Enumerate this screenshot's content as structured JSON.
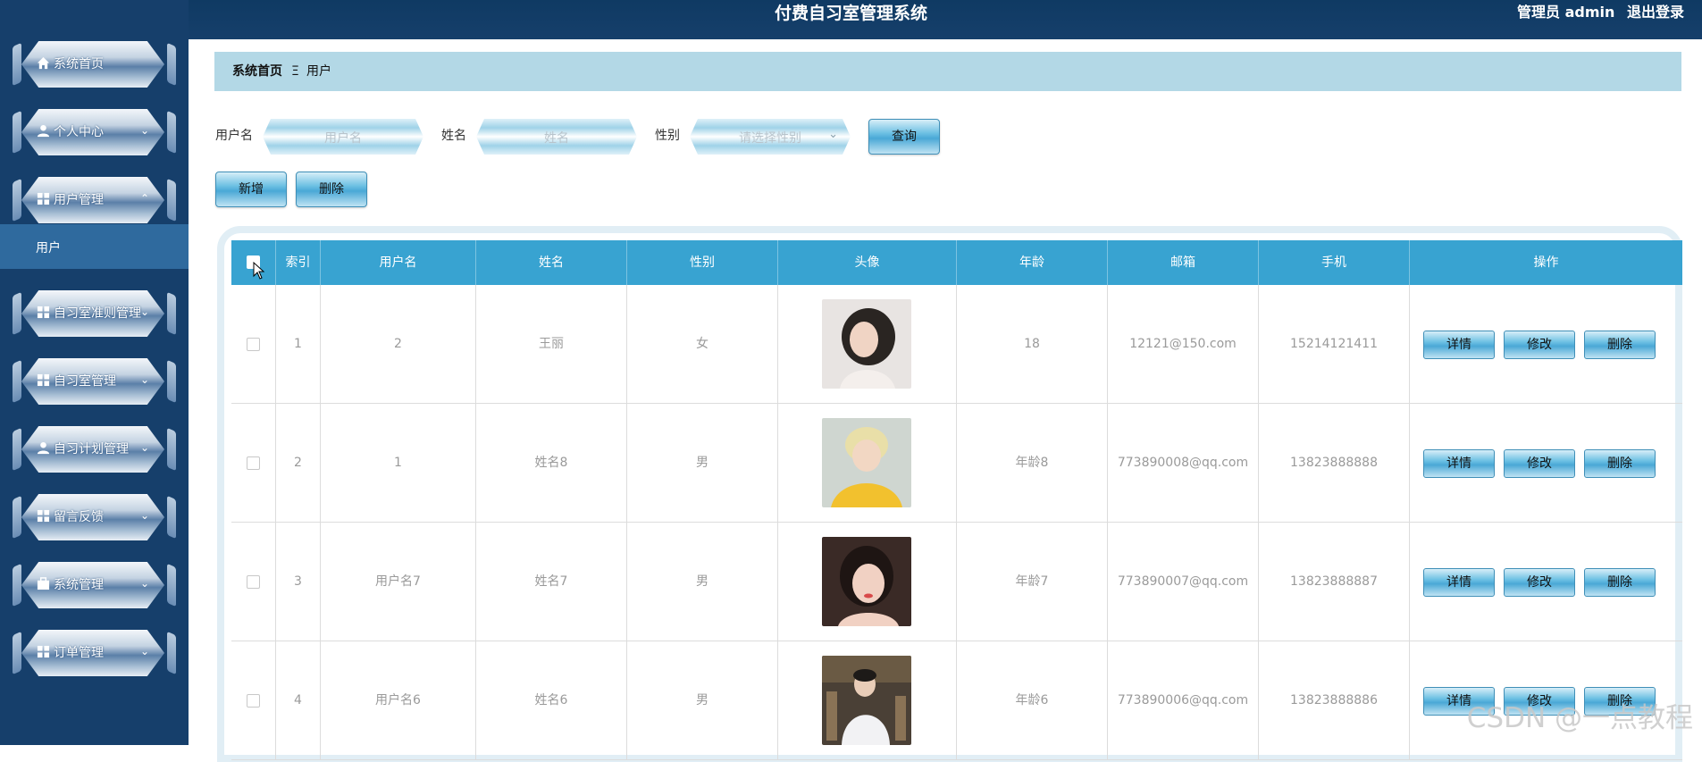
{
  "app": {
    "title": "付费自习室管理系统",
    "user": "管理员 admin",
    "logout": "退出登录"
  },
  "sidebar": {
    "items": [
      {
        "label": "系统首页",
        "icon": "home-icon"
      },
      {
        "label": "个人中心",
        "icon": "person-icon"
      },
      {
        "label": "用户管理",
        "icon": "grid-icon",
        "expanded": true
      },
      {
        "label": "自习室准则管理",
        "icon": "grid-icon"
      },
      {
        "label": "自习室管理",
        "icon": "grid-icon"
      },
      {
        "label": "自习计划管理",
        "icon": "person-icon"
      },
      {
        "label": "留言反馈",
        "icon": "grid-icon"
      },
      {
        "label": "系统管理",
        "icon": "briefcase-icon"
      },
      {
        "label": "订单管理",
        "icon": "grid-icon"
      }
    ],
    "submenu": {
      "label": "用户"
    }
  },
  "breadcrumb": {
    "home": "系统首页",
    "separator": "Ξ",
    "current": "用户"
  },
  "search": {
    "username_label": "用户名",
    "username_placeholder": "用户名",
    "name_label": "姓名",
    "name_placeholder": "姓名",
    "gender_label": "性别",
    "gender_placeholder": "请选择性别",
    "query_button": "查询"
  },
  "actions": {
    "add": "新增",
    "delete": "删除"
  },
  "table": {
    "headers": [
      "索引",
      "用户名",
      "姓名",
      "性别",
      "头像",
      "年龄",
      "邮箱",
      "手机",
      "操作"
    ],
    "rows": [
      {
        "index": "1",
        "username": "2",
        "name": "王丽",
        "gender": "女",
        "age": "18",
        "email": "12121@150.com",
        "phone": "15214121411"
      },
      {
        "index": "2",
        "username": "1",
        "name": "姓名8",
        "gender": "男",
        "age": "年龄8",
        "email": "773890008@qq.com",
        "phone": "13823888888"
      },
      {
        "index": "3",
        "username": "用户名7",
        "name": "姓名7",
        "gender": "男",
        "age": "年龄7",
        "email": "773890007@qq.com",
        "phone": "13823888887"
      },
      {
        "index": "4",
        "username": "用户名6",
        "name": "姓名6",
        "gender": "男",
        "age": "年龄6",
        "email": "773890006@qq.com",
        "phone": "13823888886"
      }
    ],
    "row_buttons": {
      "detail": "详情",
      "edit": "修改",
      "delete": "删除"
    }
  },
  "watermark": "CSDN @一点教程",
  "colors": {
    "topbar": "#0f3a63",
    "sidebar": "#163f6b",
    "header": "#38a3d1",
    "breadcrumb": "#b3d8e6"
  }
}
